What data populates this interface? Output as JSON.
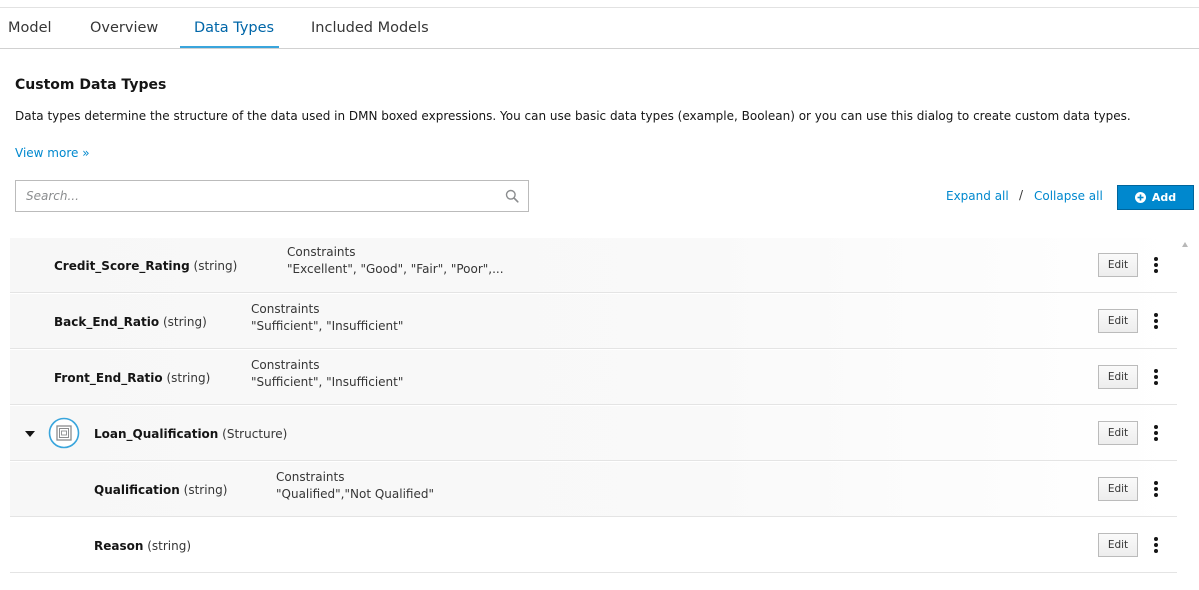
{
  "tabs": [
    {
      "label": "Model"
    },
    {
      "label": "Overview"
    },
    {
      "label": "Data Types"
    },
    {
      "label": "Included Models"
    }
  ],
  "active_tab": "Data Types",
  "header": {
    "title": "Custom Data Types",
    "description": "Data types determine the structure of the data used in DMN boxed expressions. You can use basic data types (example, Boolean) or you can use this dialog to create custom data types.",
    "view_more": "View more »"
  },
  "search": {
    "placeholder": "Search...",
    "value": ""
  },
  "toolbar": {
    "expand_all": "Expand all",
    "separator": "/",
    "collapse_all": "Collapse all",
    "add_label": "Add"
  },
  "data_types": [
    {
      "name": "Credit_Score_Rating",
      "type": "(string)",
      "constraints_label": "Constraints",
      "constraints": "\"Excellent\", \"Good\", \"Fair\", \"Poor\",...",
      "edit_label": "Edit"
    },
    {
      "name": "Back_End_Ratio",
      "type": "(string)",
      "constraints_label": "Constraints",
      "constraints": "\"Sufficient\", \"Insufficient\"",
      "edit_label": "Edit"
    },
    {
      "name": "Front_End_Ratio",
      "type": "(string)",
      "constraints_label": "Constraints",
      "constraints": "\"Sufficient\", \"Insufficient\"",
      "edit_label": "Edit"
    },
    {
      "name": "Loan_Qualification",
      "type": "(Structure)",
      "expanded": true,
      "icon": "structure-icon",
      "edit_label": "Edit"
    },
    {
      "name": "Qualification",
      "type": "(string)",
      "constraints_label": "Constraints",
      "constraints": "\"Qualified\",\"Not Qualified\"",
      "edit_label": "Edit"
    },
    {
      "name": "Reason",
      "type": "(string)",
      "edit_label": "Edit"
    }
  ],
  "colors": {
    "accent": "#0088ce",
    "active_tab": "#0066a8",
    "tab_underline": "#39a5dc"
  }
}
